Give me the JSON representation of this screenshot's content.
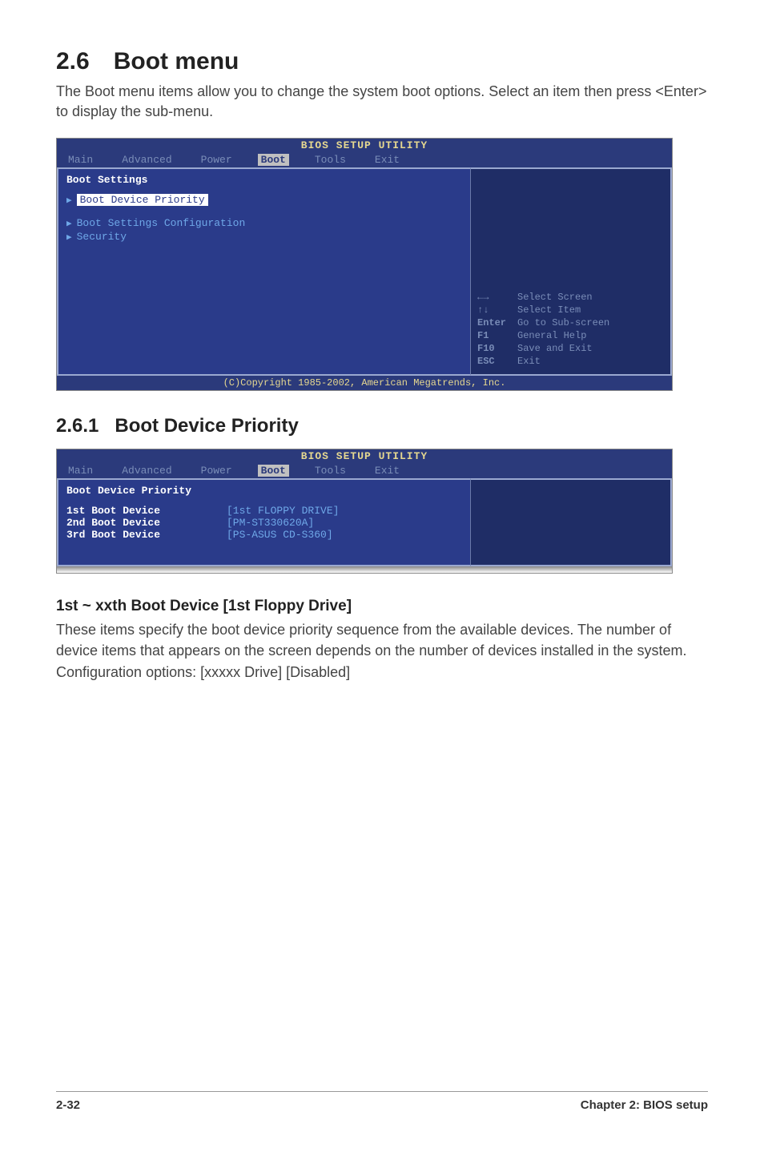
{
  "section": {
    "number": "2.6",
    "title": "Boot menu",
    "intro": "The Boot menu items allow you to change the system boot options. Select an item then press <Enter> to display the sub-menu."
  },
  "bios1": {
    "title": "BIOS SETUP UTILITY",
    "tabs": [
      "Main",
      "Advanced",
      "Power",
      "Boot",
      "Tools",
      "Exit"
    ],
    "header": "Boot Settings",
    "item1": "Boot Device Priority",
    "item2": "Boot Settings Configuration",
    "item3": "Security",
    "help": {
      "l1k": "←→",
      "l1v": "Select Screen",
      "l2k": "↑↓",
      "l2v": "Select Item",
      "l3k": "Enter",
      "l3v": "Go to Sub-screen",
      "l4k": "F1",
      "l4v": "General Help",
      "l5k": "F10",
      "l5v": "Save and Exit",
      "l6k": "ESC",
      "l6v": "Exit"
    },
    "footer": "(C)Copyright 1985-2002, American Megatrends, Inc."
  },
  "sub": {
    "number": "2.6.1",
    "title": "Boot Device Priority"
  },
  "bios2": {
    "title": "BIOS SETUP UTILITY",
    "tabs": [
      "Main",
      "Advanced",
      "Power",
      "Boot",
      "Tools",
      "Exit"
    ],
    "header": "Boot Device Priority",
    "rows": [
      {
        "label": "1st Boot Device",
        "value": "[1st FLOPPY DRIVE]"
      },
      {
        "label": "2nd Boot Device",
        "value": "[PM-ST330620A]"
      },
      {
        "label": "3rd Boot Device",
        "value": "[PS-ASUS CD-S360]"
      }
    ]
  },
  "option": {
    "title": "1st ~ xxth Boot Device [1st Floppy Drive]",
    "body1": "These items specify the boot device priority sequence from the available devices. The number of device items that appears on the screen depends on the number of devices installed in the system.",
    "body2": "Configuration options: [xxxxx Drive] [Disabled]"
  },
  "footer": {
    "page": "2-32",
    "chapter": "Chapter 2: BIOS setup"
  }
}
